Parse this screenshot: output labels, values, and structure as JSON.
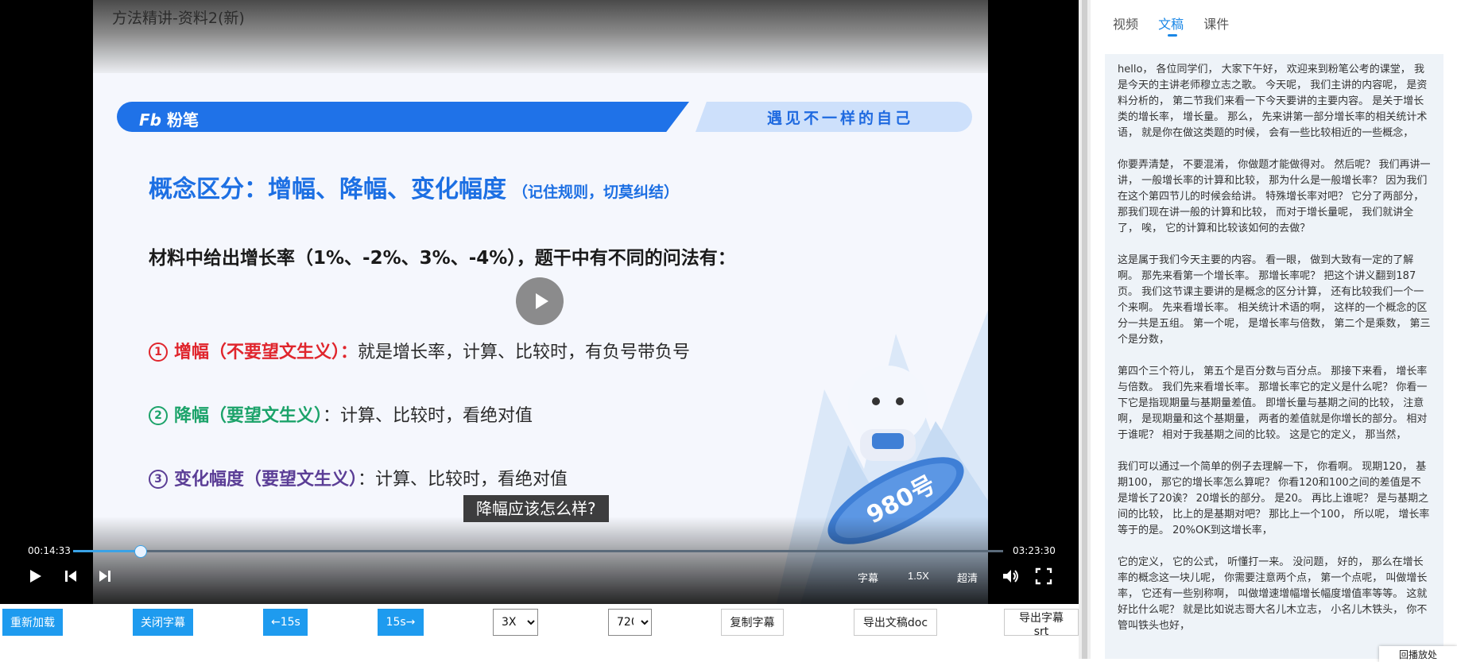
{
  "video": {
    "title": "方法精讲-资料2(新)",
    "slide": {
      "brand": "粉笔",
      "slogan": "遇见不一样的自己",
      "heading": "概念区分：增幅、降幅、变化幅度",
      "heading_note": "（记住规则，切莫纠结）",
      "lead": "材料中给出增长率（1%、-2%、3%、-4%），题干中有不同的问法有：",
      "items": [
        {
          "num": "1",
          "term": "增幅（不要望文生义）：",
          "text": "就是增长率，计算、比较时，有负号带负号"
        },
        {
          "num": "2",
          "term": "降幅（要望文生义）",
          "text": "：计算、比较时，看绝对值"
        },
        {
          "num": "3",
          "term": "变化幅度（要望文生义）",
          "text": "：计算、比较时，看绝对值"
        }
      ],
      "mascot_badge": "980号"
    },
    "subtitle": "降幅应该怎么样?",
    "current_time": "00:14:33",
    "total_time": "03:23:30",
    "progress": 0.0714,
    "controls": {
      "subtitle": "字幕",
      "speed": "1.5X",
      "quality": "超清"
    }
  },
  "toolbar": {
    "reload": "重新加载",
    "close_subtitle": "关闭字幕",
    "back15": "←15s",
    "fwd15": "15s→",
    "speed_select": {
      "selected": "3X",
      "options": [
        "3X"
      ]
    },
    "quality_select": {
      "selected": "720P",
      "options": [
        "720P"
      ]
    },
    "copy_subtitle": "复制字幕",
    "export_doc": "导出文稿doc",
    "export_srt": "导出字幕srt"
  },
  "panel": {
    "tabs": [
      "视频",
      "文稿",
      "课件"
    ],
    "active_tab": 1,
    "paragraphs": [
      "hello， 各位同学们， 大家下午好， 欢迎来到粉笔公考的课堂， 我是今天的主讲老师穆立志之歌。 今天呢， 我们主讲的内容呢， 是资料分析的， 第二节我们来看一下今天要讲的主要内容。 是关于增长类的增长率， 增长量。 那么， 先来讲第一部分增长率的相关统计术语， 就是你在做这类题的时候， 会有一些比较相近的一些概念，",
      "你要弄清楚， 不要混淆， 你做题才能做得对。 然后呢？ 我们再讲一讲， 一般增长率的计算和比较， 那为什么是一般增长率？ 因为我们在这个第四节儿的时候会给讲。 特殊增长率对吧？ 它分了两部分， 那我们现在讲一般的计算和比较， 而对于增长量呢， 我们就讲全了， 唉， 它的计算和比较该如何的去做？",
      "这是属于我们今天主要的内容。 看一眼， 做到大致有一定的了解啊。 那先来看第一个增长率。 那增长率呢？ 把这个讲义翻到187页。 我们这节课主要讲的是概念的区分计算， 还有比较我们一个一个来啊。 先来看增长率。 相关统计术语的啊， 这样的一个概念的区分一共是五组。 第一个呢， 是增长率与倍数， 第二个是乘数， 第三个是分数，",
      "第四个三个符儿， 第五个是百分数与百分点。 那接下来看， 增长率与倍数。 我们先来看增长率。 那增长率它的定义是什么呢？ 你看一下它是指现期量与基期量差值。 即增长量与基期之间的比较， 注意啊， 是现期量和这个基期量， 两者的差值就是你增长的部分。 相对于谁呢？ 相对于我基期之间的比较。 这是它的定义， 那当然，",
      "我们可以通过一个简单的例子去理解一下， 你看啊。 现期120， 基期100， 那它的增长率怎么算呢？ 你看120和100之间的差值是不是增长了20诶？ 20增长的部分。 是20。 再比上谁呢？ 是与基期之间的比较， 比上的是基期对吧？ 那比上一个100， 所以呢， 增长率等于的是。 20%OK到这增长率，",
      "它的定义， 它的公式， 听懂打一来。 没问题， 好的， 那么在增长率的概念这一块儿呢， 你需要注意两个点， 第一个点呢， 叫做增长率， 它还有一些别称啊， 叫做增速增幅增长幅度增值率等等。 这就好比什么呢？ 就是比如说志哥大名儿木立志， 小名儿木铁头， 你不管叫铁头也好，"
    ],
    "replay_button": "回播放处"
  },
  "colors": {
    "accent": "#1e9bef",
    "tab_active": "#1a87e6",
    "term_red": "#e0262d",
    "term_green": "#1ca36a",
    "term_purple": "#5b3e96",
    "heading_blue": "#1c6fe3"
  }
}
